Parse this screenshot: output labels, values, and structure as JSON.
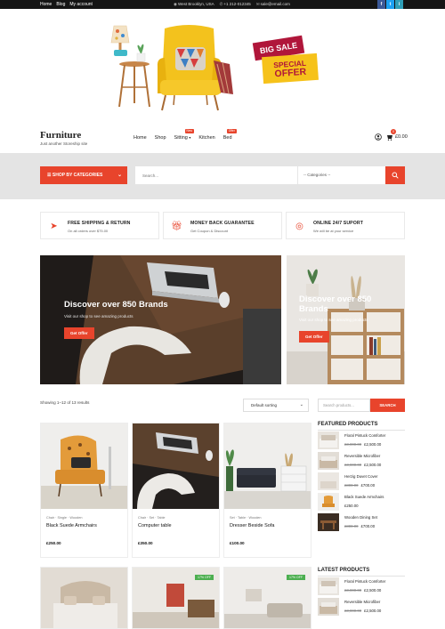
{
  "topbar": {
    "links": [
      "Home",
      "Blog",
      "My account"
    ],
    "address": "West Brooklyn, USA",
    "phone": "+1 212-012345",
    "email": "sale@email.com",
    "social": [
      "f",
      "t",
      "i"
    ]
  },
  "banner": {
    "sale_top": "BIG SALE",
    "sale_line1": "SPECIAL",
    "sale_line2": "OFFER"
  },
  "header": {
    "logo": "Furniture",
    "tagline": "Just another Storeship site",
    "nav": [
      {
        "label": "Home",
        "badge": ""
      },
      {
        "label": "Shop",
        "badge": ""
      },
      {
        "label": "Sitting",
        "badge": "New"
      },
      {
        "label": "Kitchen",
        "badge": ""
      },
      {
        "label": "Bed",
        "badge": "Offer"
      }
    ],
    "cart_total": "£0.00",
    "cart_count": "0"
  },
  "search": {
    "category_button": "SHOP BY CATEGORIES",
    "placeholder": "Search...",
    "category_select": "-- Categories --"
  },
  "features": [
    {
      "title": "FREE SHIPPING & RETURN",
      "subtitle": "On all orders over $75.00",
      "icon": "plane-icon"
    },
    {
      "title": "MONEY BACK GUARANTEE",
      "subtitle": "Get Coupon & Discount",
      "icon": "gift-icon"
    },
    {
      "title": "ONLINE 24/7 SUPORT",
      "subtitle": "We will be at your service",
      "icon": "lifebuoy-icon"
    }
  ],
  "promo": {
    "main": {
      "title": "Discover over 850 Brands",
      "subtitle": "Visit our shop to see amazing products",
      "button": "Get Offer"
    },
    "side": {
      "title": "Discover over 850 Brands",
      "subtitle": "Visit our shop to see amazing products",
      "button": "Get Offer"
    }
  },
  "shop": {
    "results": "Showing 1–12 of 13 results",
    "sort": "Default sorting",
    "search_placeholder": "Search products...",
    "search_button": "SEARCH"
  },
  "products": [
    {
      "cats": "Chair · Single · Wooden",
      "name": "Black Suede Armchairs",
      "price": "£250.00"
    },
    {
      "cats": "Chair · Set · Table",
      "name": "Computer table",
      "price": "£350.00"
    },
    {
      "cats": "Set · Table · Wooden",
      "name": "Dresser Beside Sofa",
      "price": "£100.00"
    }
  ],
  "products_row2_badges": [
    "",
    "17% OFF",
    "17% OFF"
  ],
  "sidebar": {
    "featured_title": "FEATURED PRODUCTS",
    "featured": [
      {
        "name": "Floral Pintuck Comforter",
        "old": "£3,000.00",
        "price": "£2,500.00"
      },
      {
        "name": "Reversible Microfiber",
        "old": "£3,000.00",
        "price": "£2,500.00"
      },
      {
        "name": "Herzig Duvet Cover",
        "old": "£800.00",
        "price": "£700.00"
      },
      {
        "name": "Black Suede Armchairs",
        "old": "",
        "price": "£250.00"
      },
      {
        "name": "Wooden Dining Set",
        "old": "£800.00",
        "price": "£700.00"
      }
    ],
    "latest_title": "LATEST PRODUCTS",
    "latest": [
      {
        "name": "Floral Pintuck Comforter",
        "old": "£3,000.00",
        "price": "£2,500.00"
      },
      {
        "name": "Reversible Microfiber",
        "old": "£3,000.00",
        "price": "£2,500.00"
      }
    ]
  },
  "colors": {
    "accent": "#e8442c",
    "dark": "#151515",
    "band": "#e4e4e4",
    "sale": "#4caf50"
  }
}
